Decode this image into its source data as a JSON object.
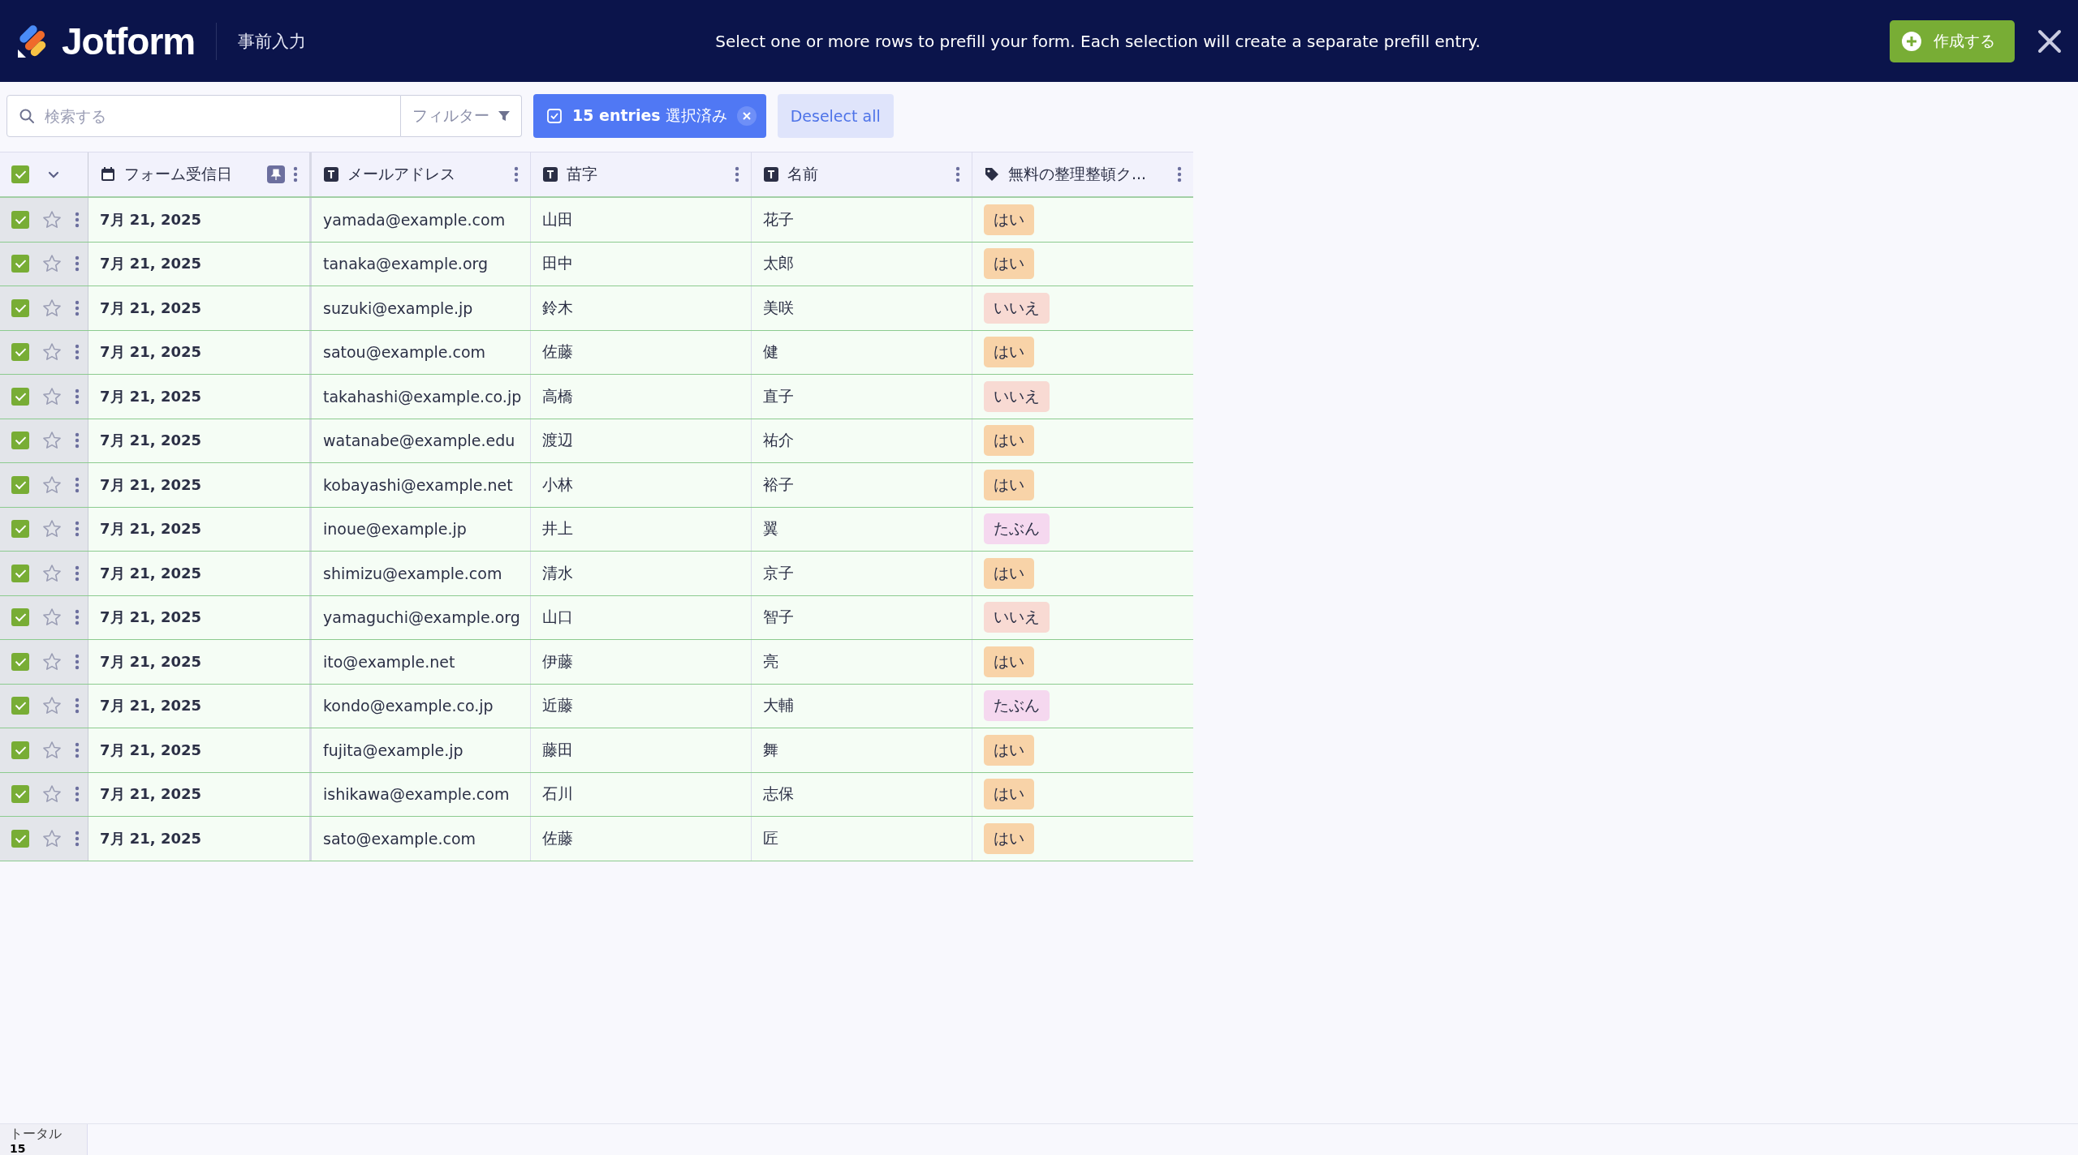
{
  "header": {
    "logo": "Jotform",
    "page_title": "事前入力",
    "message": "Select one or more rows to prefill your form. Each selection will create a separate prefill entry.",
    "create_button": "作成する"
  },
  "toolbar": {
    "search": {
      "placeholder": "検索する"
    },
    "filter": "フィルター",
    "selection": "**15 entries** 選択済み",
    "deselect": "Deselect all"
  },
  "table": {
    "all_checked": true,
    "columns": [
      {
        "label": "フォーム受信日",
        "kind": "date",
        "pinned": true
      },
      {
        "label": "メールアドレス",
        "kind": "text",
        "pinned": false
      },
      {
        "label": "苗字",
        "kind": "text",
        "pinned": false
      },
      {
        "label": "名前",
        "kind": "text",
        "pinned": false
      },
      {
        "label": "無料の整理整頓ク...",
        "kind": "tag",
        "pinned": false
      }
    ],
    "rows": [
      {
        "checked": true,
        "starred": false,
        "date": "7月 21, 2025",
        "email": "yamada@example.com",
        "surname": "山田",
        "name": "花子",
        "tag": "はい",
        "color": "#f8d3a8"
      },
      {
        "checked": true,
        "starred": false,
        "date": "7月 21, 2025",
        "email": "tanaka@example.org",
        "surname": "田中",
        "name": "太郎",
        "tag": "はい",
        "color": "#f8d3a8"
      },
      {
        "checked": true,
        "starred": false,
        "date": "7月 21, 2025",
        "email": "suzuki@example.jp",
        "surname": "鈴木",
        "name": "美咲",
        "tag": "いいえ",
        "color": "#f8dad3"
      },
      {
        "checked": true,
        "starred": false,
        "date": "7月 21, 2025",
        "email": "satou@example.com",
        "surname": "佐藤",
        "name": "健",
        "tag": "はい",
        "color": "#f8d3a8"
      },
      {
        "checked": true,
        "starred": false,
        "date": "7月 21, 2025",
        "email": "takahashi@example.co.jp",
        "surname": "高橋",
        "name": "直子",
        "tag": "いいえ",
        "color": "#f8dad3"
      },
      {
        "checked": true,
        "starred": false,
        "date": "7月 21, 2025",
        "email": "watanabe@example.edu",
        "surname": "渡辺",
        "name": "祐介",
        "tag": "はい",
        "color": "#f8d3a8"
      },
      {
        "checked": true,
        "starred": false,
        "date": "7月 21, 2025",
        "email": "kobayashi@example.net",
        "surname": "小林",
        "name": "裕子",
        "tag": "はい",
        "color": "#f8d3a8"
      },
      {
        "checked": true,
        "starred": false,
        "date": "7月 21, 2025",
        "email": "inoue@example.jp",
        "surname": "井上",
        "name": "翼",
        "tag": "たぶん",
        "color": "#f5d8ef"
      },
      {
        "checked": true,
        "starred": false,
        "date": "7月 21, 2025",
        "email": "shimizu@example.com",
        "surname": "清水",
        "name": "京子",
        "tag": "はい",
        "color": "#f8d3a8"
      },
      {
        "checked": true,
        "starred": false,
        "date": "7月 21, 2025",
        "email": "yamaguchi@example.org",
        "surname": "山口",
        "name": "智子",
        "tag": "いいえ",
        "color": "#f8dad3"
      },
      {
        "checked": true,
        "starred": false,
        "date": "7月 21, 2025",
        "email": "ito@example.net",
        "surname": "伊藤",
        "name": "亮",
        "tag": "はい",
        "color": "#f8d3a8"
      },
      {
        "checked": true,
        "starred": false,
        "date": "7月 21, 2025",
        "email": "kondo@example.co.jp",
        "surname": "近藤",
        "name": "大輔",
        "tag": "たぶん",
        "color": "#f5d8ef"
      },
      {
        "checked": true,
        "starred": false,
        "date": "7月 21, 2025",
        "email": "fujita@example.jp",
        "surname": "藤田",
        "name": "舞",
        "tag": "はい",
        "color": "#f8d3a8"
      },
      {
        "checked": true,
        "starred": false,
        "date": "7月 21, 2025",
        "email": "ishikawa@example.com",
        "surname": "石川",
        "name": "志保",
        "tag": "はい",
        "color": "#f8d3a8"
      },
      {
        "checked": true,
        "starred": false,
        "date": "7月 21, 2025",
        "email": "sato@example.com",
        "surname": "佐藤",
        "name": "匠",
        "tag": "はい",
        "color": "#f8d3a8"
      }
    ]
  },
  "footer": {
    "label": "トータル",
    "count": "15"
  }
}
